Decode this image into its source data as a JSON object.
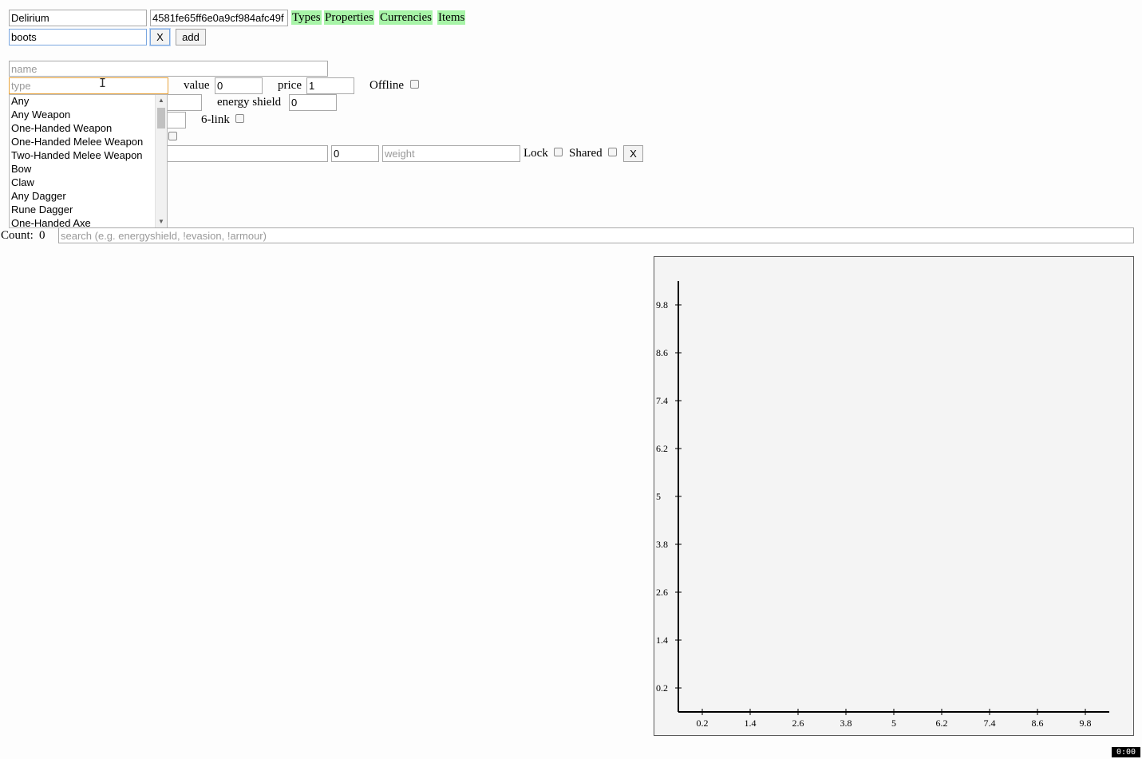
{
  "top": {
    "league_value": "Delirium",
    "session_value": "4581fe65ff6e0a9cf984afc49f",
    "nav": [
      "Types",
      "Properties",
      "Currencies",
      "Items"
    ],
    "profile_value": "boots",
    "remove_label": "X",
    "add_label": "add"
  },
  "form": {
    "name_placeholder": "name",
    "type_placeholder": "type",
    "value_label": "value",
    "value_value": "0",
    "price_label": "price",
    "price_value": "1",
    "offline_label": "Offline",
    "energy_shield_label": "energy shield",
    "energy_shield_value": "0",
    "six_link_label": "6-link",
    "modifier_value": "0",
    "weight_placeholder": "weight",
    "lock_label": "Lock",
    "shared_label": "Shared",
    "remove_label": "X"
  },
  "type_options": [
    "Any",
    "Any Weapon",
    "One-Handed Weapon",
    "One-Handed Melee Weapon",
    "Two-Handed Melee Weapon",
    "Bow",
    "Claw",
    "Any Dagger",
    "Rune Dagger",
    "One-Handed Axe"
  ],
  "results": {
    "count_label": "Count:",
    "count_value": "0",
    "search_placeholder": "search (e.g. energyshield, !evasion, !armour)"
  },
  "chart_data": {
    "type": "scatter",
    "x_ticks": [
      "0.2",
      "1.4",
      "2.6",
      "3.8",
      "5",
      "6.2",
      "7.4",
      "8.6",
      "9.8"
    ],
    "y_ticks": [
      "0.2",
      "1.4",
      "2.6",
      "3.8",
      "5",
      "6.2",
      "7.4",
      "8.6",
      "9.8"
    ],
    "xlim": [
      -0.4,
      10.6
    ],
    "ylim": [
      -0.4,
      10.6
    ],
    "points": []
  },
  "timer": "0:00"
}
